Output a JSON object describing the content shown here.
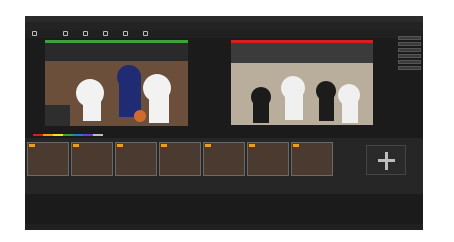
{
  "window": {
    "title": ""
  },
  "menu": {
    "items": [
      "",
      "",
      "",
      "",
      "",
      ""
    ]
  },
  "top_right": {
    "items": [
      "",
      "",
      "",
      ""
    ]
  },
  "toolbar": {
    "items": [
      "",
      "",
      "",
      "",
      "",
      ""
    ]
  },
  "preview": {
    "label": ""
  },
  "program": {
    "label": ""
  },
  "right_panel": {
    "buttons": [
      "",
      "",
      "",
      "",
      "",
      ""
    ]
  },
  "strip": {
    "items": [
      {
        "label": ""
      },
      {
        "label": ""
      },
      {
        "label": ""
      },
      {
        "label": ""
      },
      {
        "label": ""
      },
      {
        "label": ""
      },
      {
        "label": ""
      }
    ]
  },
  "bottom": {
    "status": ""
  }
}
